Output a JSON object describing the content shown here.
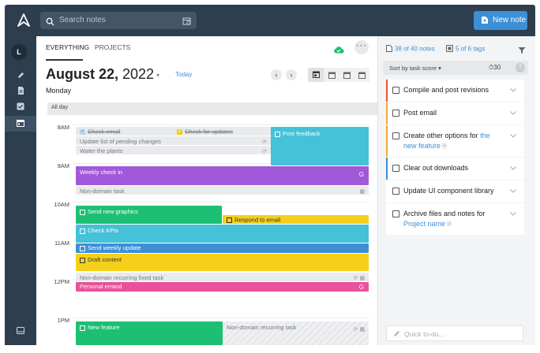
{
  "search": {
    "placeholder": "Search notes"
  },
  "toolbar": {
    "new_note_label": "New note"
  },
  "user": {
    "initial": "L"
  },
  "tabs": [
    {
      "label": "EVERYTHING"
    },
    {
      "label": "PROJECTS"
    }
  ],
  "calendar": {
    "date_month_day": "August 22,",
    "date_year": " 2022",
    "weekday": "Monday",
    "today_label": "Today",
    "all_day_label": "All day",
    "hours": [
      "8AM",
      "9AM",
      "10AM",
      "11AM",
      "12PM",
      "1PM"
    ],
    "events": {
      "check_email": "Check email",
      "check_updates": "Check for updates",
      "update_list": "Update list of pending changes",
      "water_plants": "Water the plants",
      "post_feedback": "Post feedback",
      "weekly_checkin": "Weekly check in",
      "weekly_checkin_badge": "G",
      "non_domain_task": "Non-domain task",
      "send_graphics": "Send new graphics",
      "respond_email": "Respond to email",
      "check_kpis": "Check KPIs",
      "send_weekly_update": "Send weekly update",
      "draft_content": "Draft content",
      "non_domain_recurring_fixed": "Non-domain recurring fixed task",
      "personal_errand": "Personal errand",
      "personal_errand_badge": "G",
      "new_feature": "New feature",
      "non_domain_recurring": "Non-domain recurring task"
    }
  },
  "taskpane": {
    "notes_count": "38 of 40 notes",
    "tags_count": "5 of 6 tags",
    "sort_label": "Sort by task score",
    "timer": "30",
    "help": "?",
    "tasks": [
      {
        "text": "Compile and post revisions",
        "color": "#e05a3a"
      },
      {
        "text": "Post email",
        "color": "#f2a93b"
      },
      {
        "text": "Create other options for ",
        "link": "the new feature",
        "color": "#f2a93b"
      },
      {
        "text": "Clear out downloads",
        "color": "#3d8fd6"
      },
      {
        "text": "Update UI component library",
        "color": "#ffffff"
      },
      {
        "text": "Archive files and notes for ",
        "link": "Project name",
        "color": "#ffffff"
      }
    ],
    "quick_add_placeholder": "Quick to-do..."
  },
  "colors": {
    "purple": "#a259d9",
    "green": "#1dbf73",
    "cyan": "#45c1d8",
    "yellow": "#f5d01a",
    "blue": "#3d8fd6",
    "pink": "#e9519a",
    "dark": "#2d3e4f"
  }
}
